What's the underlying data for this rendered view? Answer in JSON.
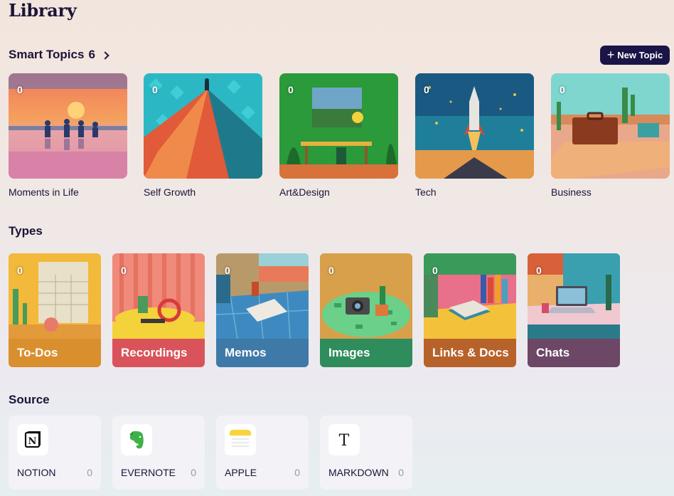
{
  "page": {
    "title": "Library"
  },
  "smart_topics": {
    "title": "Smart Topics",
    "count": "6",
    "new_topic_label": "New Topic",
    "items": [
      {
        "label": "Moments in Life",
        "count": "0"
      },
      {
        "label": "Self Growth",
        "count": "0"
      },
      {
        "label": "Art&Design",
        "count": "0"
      },
      {
        "label": "Tech",
        "count": "0"
      },
      {
        "label": "Business",
        "count": "0"
      }
    ]
  },
  "types": {
    "title": "Types",
    "items": [
      {
        "label": "To-Dos",
        "count": "0",
        "color": "#d98f2e"
      },
      {
        "label": "Recordings",
        "count": "0",
        "color": "#d9545a"
      },
      {
        "label": "Memos",
        "count": "0",
        "color": "#3f79a8"
      },
      {
        "label": "Images",
        "count": "0",
        "color": "#2f8c5c"
      },
      {
        "label": "Links & Docs",
        "count": "0",
        "color": "#b8622b"
      },
      {
        "label": "Chats",
        "count": "0",
        "color": "#6d4766"
      }
    ]
  },
  "source": {
    "title": "Source",
    "items": [
      {
        "name": "NOTION",
        "count": "0",
        "icon": "notion-icon"
      },
      {
        "name": "EVERNOTE",
        "count": "0",
        "icon": "evernote-icon"
      },
      {
        "name": "APPLE",
        "count": "0",
        "icon": "apple-notes-icon"
      },
      {
        "name": "MARKDOWN",
        "count": "0",
        "icon": "markdown-icon"
      }
    ]
  }
}
